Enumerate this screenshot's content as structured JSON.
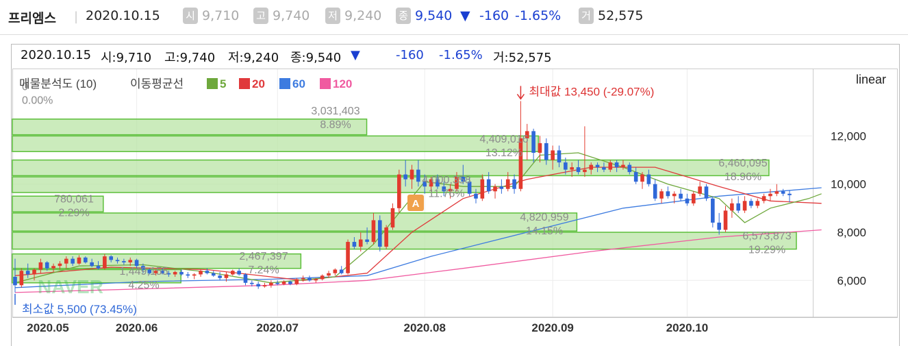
{
  "header": {
    "name": "프리엠스",
    "date": "2020.10.15",
    "open_label": "시",
    "open": "9,710",
    "high_label": "고",
    "high": "9,740",
    "low_label": "저",
    "low": "9,240",
    "close_label": "종",
    "close": "9,540",
    "change_arrow": "▼",
    "change": "-160",
    "change_pct": "-1.65%",
    "volume_label": "거",
    "volume": "52,575"
  },
  "info": {
    "date": "2020.10.15",
    "open": "시:9,710",
    "high": "고:9,740",
    "low": "저:9,240",
    "close": "종:9,540",
    "arrow": "▼",
    "change": "-160",
    "change_pct": "-1.65%",
    "volume": "거:52,575"
  },
  "legend": {
    "title": "매물분석도 (10)",
    "ma_label": "이동평균선",
    "ma": [
      {
        "period": "5",
        "color": "#6ea83c"
      },
      {
        "period": "20",
        "color": "#e0393b"
      },
      {
        "period": "60",
        "color": "#3d7be0"
      },
      {
        "period": "120",
        "color": "#f05aa0"
      }
    ]
  },
  "scale_label": "linear",
  "annotations": {
    "max": "최대값 13,450 (-29.07%)",
    "min": "최소값 5,500 (73.45%)",
    "marker": "A",
    "watermark": "NAVER"
  },
  "chart_data": {
    "type": "candlestick",
    "y_ticks": [
      "12,000",
      "10,000",
      "8,000",
      "6,000"
    ],
    "y_tick_values": [
      12000,
      10000,
      8000,
      6000
    ],
    "ylim": [
      4500,
      14800
    ],
    "x_ticks": [
      "2020.05",
      "2020.06",
      "2020.07",
      "2020.08",
      "2020.09",
      "2020.10"
    ],
    "volume_profile": [
      {
        "price_low": 12050,
        "price_high": 12700,
        "volume": "3,031,403",
        "pct": "8.89%",
        "rel": 0.452
      },
      {
        "price_low": 11350,
        "price_high": 12000,
        "volume": "4,409,016",
        "pct": "13.12%",
        "rel": 0.671
      },
      {
        "price_low": 10350,
        "price_high": 11000,
        "volume": "6,460,095",
        "pct": "18.96%",
        "rel": 0.965
      },
      {
        "price_low": 9650,
        "price_high": 10300,
        "volume": "4,000,358",
        "pct": "11.76%",
        "rel": 0.6
      },
      {
        "price_low": 8850,
        "price_high": 9500,
        "volume": "780,061",
        "pct": "2.29%",
        "rel": 0.116
      },
      {
        "price_low": 8050,
        "price_high": 8800,
        "volume": "4,820,959",
        "pct": "14.15%",
        "rel": 0.72
      },
      {
        "price_low": 7300,
        "price_high": 8000,
        "volume": "6,573,873",
        "pct": "19.29%",
        "rel": 1.0
      },
      {
        "price_low": 6500,
        "price_high": 7100,
        "volume": "2,467,397",
        "pct": "7.24%",
        "rel": 0.368
      },
      {
        "price_low": 5900,
        "price_high": 6450,
        "volume": "1,449,155",
        "pct": "4.25%",
        "rel": 0.215
      },
      {
        "price_low": 13600,
        "price_high": 14100,
        "volume": "0",
        "pct": "0.00%",
        "rel": 0.0
      }
    ],
    "candles": [
      {
        "d": "05-04",
        "o": 6150,
        "h": 6900,
        "l": 5500,
        "c": 5800
      },
      {
        "d": "05-06",
        "o": 5800,
        "h": 6500,
        "l": 5700,
        "c": 6400
      },
      {
        "d": "05-07",
        "o": 6400,
        "h": 6700,
        "l": 6100,
        "c": 6250
      },
      {
        "d": "05-08",
        "o": 6250,
        "h": 6500,
        "l": 6000,
        "c": 6450
      },
      {
        "d": "05-11",
        "o": 6450,
        "h": 6900,
        "l": 6300,
        "c": 6750
      },
      {
        "d": "05-12",
        "o": 6750,
        "h": 6800,
        "l": 6400,
        "c": 6500
      },
      {
        "d": "05-13",
        "o": 6500,
        "h": 6700,
        "l": 6350,
        "c": 6600
      },
      {
        "d": "05-14",
        "o": 6600,
        "h": 6800,
        "l": 6450,
        "c": 6700
      },
      {
        "d": "05-15",
        "o": 6700,
        "h": 7000,
        "l": 6500,
        "c": 6900
      },
      {
        "d": "05-18",
        "o": 6900,
        "h": 7000,
        "l": 6600,
        "c": 6700
      },
      {
        "d": "05-19",
        "o": 6700,
        "h": 7050,
        "l": 6650,
        "c": 6950
      },
      {
        "d": "05-20",
        "o": 6950,
        "h": 7000,
        "l": 6700,
        "c": 6750
      },
      {
        "d": "05-21",
        "o": 6750,
        "h": 6900,
        "l": 6550,
        "c": 6600
      },
      {
        "d": "05-22",
        "o": 6600,
        "h": 6800,
        "l": 6450,
        "c": 6500
      },
      {
        "d": "05-25",
        "o": 6500,
        "h": 7100,
        "l": 6450,
        "c": 7000
      },
      {
        "d": "05-26",
        "o": 7000,
        "h": 7050,
        "l": 6750,
        "c": 6850
      },
      {
        "d": "05-27",
        "o": 6850,
        "h": 6950,
        "l": 6700,
        "c": 6800
      },
      {
        "d": "05-28",
        "o": 6800,
        "h": 6900,
        "l": 6650,
        "c": 6750
      },
      {
        "d": "05-29",
        "o": 6750,
        "h": 6950,
        "l": 6600,
        "c": 6850
      },
      {
        "d": "06-01",
        "o": 6850,
        "h": 6900,
        "l": 6500,
        "c": 6600
      },
      {
        "d": "06-02",
        "o": 6600,
        "h": 6700,
        "l": 6300,
        "c": 6450
      },
      {
        "d": "06-03",
        "o": 6450,
        "h": 6500,
        "l": 6250,
        "c": 6300
      },
      {
        "d": "06-04",
        "o": 6300,
        "h": 6450,
        "l": 6200,
        "c": 6400
      },
      {
        "d": "06-05",
        "o": 6400,
        "h": 6500,
        "l": 6250,
        "c": 6300
      },
      {
        "d": "06-08",
        "o": 6300,
        "h": 6400,
        "l": 6150,
        "c": 6250
      },
      {
        "d": "06-09",
        "o": 6250,
        "h": 6400,
        "l": 6150,
        "c": 6350
      },
      {
        "d": "06-10",
        "o": 6350,
        "h": 6450,
        "l": 6200,
        "c": 6250
      },
      {
        "d": "06-11",
        "o": 6250,
        "h": 6350,
        "l": 6100,
        "c": 6200
      },
      {
        "d": "06-12",
        "o": 6200,
        "h": 6300,
        "l": 6050,
        "c": 6250
      },
      {
        "d": "06-15",
        "o": 6250,
        "h": 6450,
        "l": 6150,
        "c": 6400
      },
      {
        "d": "06-16",
        "o": 6400,
        "h": 6500,
        "l": 6250,
        "c": 6300
      },
      {
        "d": "06-17",
        "o": 6300,
        "h": 6400,
        "l": 6150,
        "c": 6200
      },
      {
        "d": "06-18",
        "o": 6200,
        "h": 6350,
        "l": 6000,
        "c": 6100
      },
      {
        "d": "06-19",
        "o": 6100,
        "h": 6350,
        "l": 5950,
        "c": 6250
      },
      {
        "d": "06-22",
        "o": 6250,
        "h": 6450,
        "l": 6200,
        "c": 6400
      },
      {
        "d": "06-23",
        "o": 6400,
        "h": 6500,
        "l": 6200,
        "c": 6250
      },
      {
        "d": "06-24",
        "o": 6250,
        "h": 6300,
        "l": 5800,
        "c": 5900
      },
      {
        "d": "06-25",
        "o": 5900,
        "h": 6000,
        "l": 5750,
        "c": 5850
      },
      {
        "d": "06-26",
        "o": 5850,
        "h": 5950,
        "l": 5650,
        "c": 5750
      },
      {
        "d": "06-29",
        "o": 5750,
        "h": 5900,
        "l": 5700,
        "c": 5800
      },
      {
        "d": "06-30",
        "o": 5800,
        "h": 6000,
        "l": 5700,
        "c": 5900
      },
      {
        "d": "07-01",
        "o": 5900,
        "h": 6000,
        "l": 5800,
        "c": 5850
      },
      {
        "d": "07-02",
        "o": 5850,
        "h": 6000,
        "l": 5800,
        "c": 5950
      },
      {
        "d": "07-03",
        "o": 5950,
        "h": 6000,
        "l": 5800,
        "c": 5850
      },
      {
        "d": "07-06",
        "o": 5850,
        "h": 6100,
        "l": 5800,
        "c": 6050
      },
      {
        "d": "07-07",
        "o": 6050,
        "h": 6200,
        "l": 5950,
        "c": 6100
      },
      {
        "d": "07-08",
        "o": 6100,
        "h": 6200,
        "l": 5950,
        "c": 6000
      },
      {
        "d": "07-09",
        "o": 6000,
        "h": 6100,
        "l": 5900,
        "c": 6050
      },
      {
        "d": "07-10",
        "o": 6050,
        "h": 6250,
        "l": 6000,
        "c": 6200
      },
      {
        "d": "07-13",
        "o": 6200,
        "h": 6400,
        "l": 6100,
        "c": 6300
      },
      {
        "d": "07-14",
        "o": 6300,
        "h": 6500,
        "l": 6200,
        "c": 6450
      },
      {
        "d": "07-15",
        "o": 6450,
        "h": 6600,
        "l": 6250,
        "c": 6300
      },
      {
        "d": "07-16",
        "o": 6300,
        "h": 7700,
        "l": 6250,
        "c": 7600
      },
      {
        "d": "07-17",
        "o": 7600,
        "h": 7800,
        "l": 7300,
        "c": 7400
      },
      {
        "d": "07-20",
        "o": 7400,
        "h": 8000,
        "l": 7200,
        "c": 7700
      },
      {
        "d": "07-21",
        "o": 7700,
        "h": 8200,
        "l": 7500,
        "c": 7600
      },
      {
        "d": "07-22",
        "o": 7600,
        "h": 8800,
        "l": 7500,
        "c": 8500
      },
      {
        "d": "07-23",
        "o": 8500,
        "h": 8700,
        "l": 7200,
        "c": 7400
      },
      {
        "d": "07-24",
        "o": 7400,
        "h": 8300,
        "l": 7300,
        "c": 8200
      },
      {
        "d": "07-27",
        "o": 8200,
        "h": 9200,
        "l": 8100,
        "c": 9000
      },
      {
        "d": "07-28",
        "o": 9000,
        "h": 10600,
        "l": 8800,
        "c": 10400
      },
      {
        "d": "07-29",
        "o": 10400,
        "h": 11000,
        "l": 9900,
        "c": 10200
      },
      {
        "d": "07-30",
        "o": 10200,
        "h": 10800,
        "l": 9800,
        "c": 10600
      },
      {
        "d": "07-31",
        "o": 10600,
        "h": 11000,
        "l": 9900,
        "c": 10100
      },
      {
        "d": "08-03",
        "o": 10100,
        "h": 10400,
        "l": 9600,
        "c": 9900
      },
      {
        "d": "08-04",
        "o": 9900,
        "h": 10300,
        "l": 9700,
        "c": 10200
      },
      {
        "d": "08-05",
        "o": 10200,
        "h": 10400,
        "l": 9800,
        "c": 9900
      },
      {
        "d": "08-06",
        "o": 9900,
        "h": 10100,
        "l": 9500,
        "c": 9700
      },
      {
        "d": "08-07",
        "o": 9700,
        "h": 10000,
        "l": 9400,
        "c": 9800
      },
      {
        "d": "08-10",
        "o": 9800,
        "h": 10500,
        "l": 9700,
        "c": 10300
      },
      {
        "d": "08-11",
        "o": 10300,
        "h": 10800,
        "l": 10000,
        "c": 10100
      },
      {
        "d": "08-12",
        "o": 10100,
        "h": 10300,
        "l": 9500,
        "c": 9600
      },
      {
        "d": "08-13",
        "o": 9600,
        "h": 9800,
        "l": 9200,
        "c": 9400
      },
      {
        "d": "08-14",
        "o": 9400,
        "h": 10400,
        "l": 9300,
        "c": 10200
      },
      {
        "d": "08-18",
        "o": 10200,
        "h": 10500,
        "l": 9600,
        "c": 9700
      },
      {
        "d": "08-19",
        "o": 9700,
        "h": 10000,
        "l": 9400,
        "c": 9900
      },
      {
        "d": "08-20",
        "o": 9900,
        "h": 10200,
        "l": 9600,
        "c": 9800
      },
      {
        "d": "08-21",
        "o": 9800,
        "h": 10500,
        "l": 9700,
        "c": 10200
      },
      {
        "d": "08-24",
        "o": 10200,
        "h": 10400,
        "l": 9600,
        "c": 9800
      },
      {
        "d": "08-25",
        "o": 9800,
        "h": 13450,
        "l": 9700,
        "c": 11900
      },
      {
        "d": "08-26",
        "o": 11900,
        "h": 12500,
        "l": 11000,
        "c": 12200
      },
      {
        "d": "08-27",
        "o": 12200,
        "h": 12300,
        "l": 10900,
        "c": 11300
      },
      {
        "d": "08-28",
        "o": 11300,
        "h": 12000,
        "l": 10900,
        "c": 11700
      },
      {
        "d": "08-31",
        "o": 11700,
        "h": 11900,
        "l": 10800,
        "c": 11000
      },
      {
        "d": "09-01",
        "o": 11000,
        "h": 11600,
        "l": 10600,
        "c": 11400
      },
      {
        "d": "09-02",
        "o": 11400,
        "h": 11600,
        "l": 10700,
        "c": 10900
      },
      {
        "d": "09-03",
        "o": 10900,
        "h": 11100,
        "l": 10400,
        "c": 10600
      },
      {
        "d": "09-04",
        "o": 10600,
        "h": 10900,
        "l": 10300,
        "c": 10700
      },
      {
        "d": "09-07",
        "o": 10700,
        "h": 11000,
        "l": 10400,
        "c": 10500
      },
      {
        "d": "09-08",
        "o": 10500,
        "h": 12400,
        "l": 10300,
        "c": 10600
      },
      {
        "d": "09-09",
        "o": 10600,
        "h": 10900,
        "l": 10400,
        "c": 10800
      },
      {
        "d": "09-10",
        "o": 10800,
        "h": 10900,
        "l": 10500,
        "c": 10700
      },
      {
        "d": "09-11",
        "o": 10700,
        "h": 10900,
        "l": 10500,
        "c": 10600
      },
      {
        "d": "09-14",
        "o": 10600,
        "h": 11000,
        "l": 10500,
        "c": 10900
      },
      {
        "d": "09-15",
        "o": 10900,
        "h": 11000,
        "l": 10500,
        "c": 10700
      },
      {
        "d": "09-16",
        "o": 10700,
        "h": 11000,
        "l": 10600,
        "c": 10800
      },
      {
        "d": "09-17",
        "o": 10800,
        "h": 10900,
        "l": 10400,
        "c": 10500
      },
      {
        "d": "09-18",
        "o": 10500,
        "h": 10700,
        "l": 10000,
        "c": 10100
      },
      {
        "d": "09-21",
        "o": 10100,
        "h": 10500,
        "l": 9800,
        "c": 10400
      },
      {
        "d": "09-22",
        "o": 10400,
        "h": 10600,
        "l": 9900,
        "c": 10000
      },
      {
        "d": "09-23",
        "o": 10000,
        "h": 10200,
        "l": 9300,
        "c": 9400
      },
      {
        "d": "09-24",
        "o": 9400,
        "h": 9800,
        "l": 9200,
        "c": 9700
      },
      {
        "d": "09-25",
        "o": 9700,
        "h": 9900,
        "l": 9400,
        "c": 9500
      },
      {
        "d": "09-28",
        "o": 9500,
        "h": 9700,
        "l": 9200,
        "c": 9600
      },
      {
        "d": "09-29",
        "o": 9600,
        "h": 9800,
        "l": 9300,
        "c": 9400
      },
      {
        "d": "10-05",
        "o": 9400,
        "h": 9600,
        "l": 9100,
        "c": 9200
      },
      {
        "d": "10-06",
        "o": 9200,
        "h": 9700,
        "l": 9100,
        "c": 9600
      },
      {
        "d": "10-07",
        "o": 9600,
        "h": 10100,
        "l": 9500,
        "c": 9900
      },
      {
        "d": "10-08",
        "o": 9900,
        "h": 10000,
        "l": 9300,
        "c": 9400
      },
      {
        "d": "10-12",
        "o": 9400,
        "h": 9500,
        "l": 8200,
        "c": 8400
      },
      {
        "d": "10-13",
        "o": 8400,
        "h": 8800,
        "l": 7900,
        "c": 8100
      },
      {
        "d": "10-14",
        "o": 8100,
        "h": 9100,
        "l": 8000,
        "c": 8900
      },
      {
        "d": "10-15",
        "o": 8900,
        "h": 9400,
        "l": 8600,
        "c": 9200
      },
      {
        "d": "10-16",
        "o": 9200,
        "h": 9500,
        "l": 8800,
        "c": 8900
      },
      {
        "d": "10-19",
        "o": 8900,
        "h": 9500,
        "l": 8800,
        "c": 9300
      },
      {
        "d": "10-20",
        "o": 9300,
        "h": 9400,
        "l": 9000,
        "c": 9100
      },
      {
        "d": "10-21",
        "o": 9100,
        "h": 9400,
        "l": 9000,
        "c": 9300
      },
      {
        "d": "10-22",
        "o": 9300,
        "h": 9600,
        "l": 9200,
        "c": 9500
      },
      {
        "d": "10-23",
        "o": 9500,
        "h": 9800,
        "l": 9300,
        "c": 9600
      },
      {
        "d": "10-26",
        "o": 9600,
        "h": 10000,
        "l": 9500,
        "c": 9700
      },
      {
        "d": "10-27",
        "o": 9700,
        "h": 9800,
        "l": 9500,
        "c": 9600
      },
      {
        "d": "10-28",
        "o": 9600,
        "h": 9740,
        "l": 9240,
        "c": 9540
      }
    ],
    "ma_lines": {
      "5": [
        [
          0,
          5900
        ],
        [
          10,
          6600
        ],
        [
          20,
          6650
        ],
        [
          30,
          6350
        ],
        [
          40,
          5900
        ],
        [
          50,
          6150
        ],
        [
          56,
          7500
        ],
        [
          60,
          8800
        ],
        [
          64,
          10100
        ],
        [
          70,
          9900
        ],
        [
          78,
          9900
        ],
        [
          82,
          11200
        ],
        [
          88,
          11300
        ],
        [
          95,
          10700
        ],
        [
          102,
          10000
        ],
        [
          110,
          9400
        ],
        [
          114,
          8400
        ],
        [
          118,
          9000
        ],
        [
          124,
          9400
        ],
        [
          126,
          9600
        ]
      ],
      "20": [
        [
          0,
          6200
        ],
        [
          15,
          6550
        ],
        [
          30,
          6450
        ],
        [
          45,
          6000
        ],
        [
          55,
          6300
        ],
        [
          62,
          8000
        ],
        [
          70,
          9400
        ],
        [
          80,
          10200
        ],
        [
          90,
          10700
        ],
        [
          100,
          10700
        ],
        [
          110,
          9900
        ],
        [
          118,
          9300
        ],
        [
          126,
          9200
        ]
      ],
      "60": [
        [
          0,
          5700
        ],
        [
          20,
          5950
        ],
        [
          40,
          6050
        ],
        [
          55,
          6200
        ],
        [
          65,
          7000
        ],
        [
          80,
          8000
        ],
        [
          95,
          9000
        ],
        [
          110,
          9500
        ],
        [
          126,
          9850
        ]
      ],
      "120": [
        [
          0,
          5500
        ],
        [
          20,
          5650
        ],
        [
          40,
          5800
        ],
        [
          55,
          6000
        ],
        [
          70,
          6500
        ],
        [
          90,
          7200
        ],
        [
          110,
          7800
        ],
        [
          126,
          8100
        ]
      ]
    }
  }
}
